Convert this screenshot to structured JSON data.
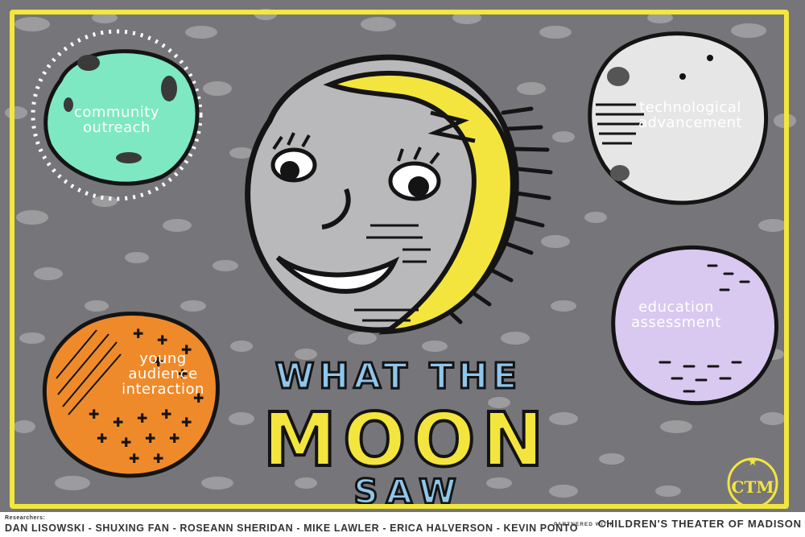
{
  "planets": {
    "community": "community\noutreach",
    "technology": "technological\nadvancement",
    "education": "education\nassessment",
    "audience": "young\naudience\ninteraction"
  },
  "title": {
    "line1": "WHAT THE",
    "line2": "MOON",
    "line3": "SAW"
  },
  "footer": {
    "researchers_label": "Researchers:",
    "researchers": "DAN LISOWSKI - SHUXING FAN - ROSEANN SHERIDAN - MIKE LAWLER - ERICA HALVERSON - KEVIN PONTO",
    "partner_label": "PARTNERED WITH:",
    "partner": "CHILDREN'S THEATER OF MADISON",
    "logo_text": "CTM"
  },
  "colors": {
    "background": "#76767a",
    "frame": "#f2e73c",
    "moon_yellow": "#f4e53e",
    "community": "#7ee8c3",
    "technology": "#e6e6e6",
    "education": "#d9c8f0",
    "audience": "#ef8a2a",
    "title_blue": "#8ec6ec",
    "title_yellow": "#f4e53e"
  }
}
